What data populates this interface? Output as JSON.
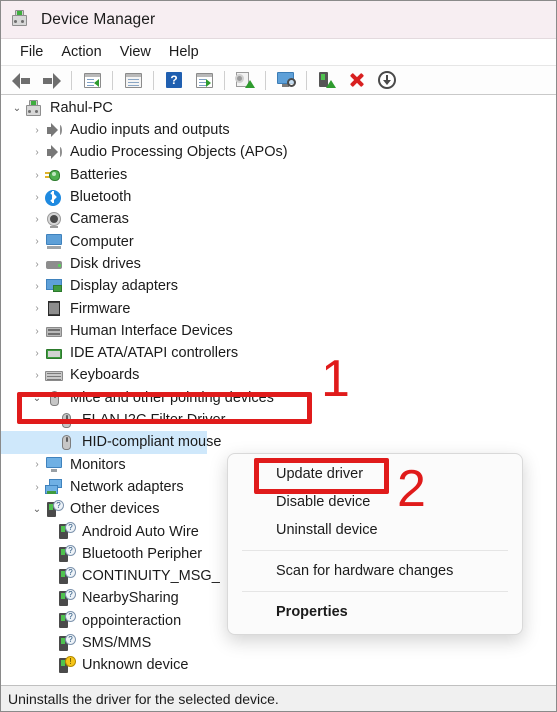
{
  "window": {
    "title": "Device Manager",
    "title_icon": "device-manager-icon"
  },
  "menubar": {
    "items": [
      {
        "label": "File"
      },
      {
        "label": "Action"
      },
      {
        "label": "View"
      },
      {
        "label": "Help"
      }
    ]
  },
  "toolbar": {
    "buttons": [
      {
        "icon": "back-arrow-icon",
        "label": "Back"
      },
      {
        "icon": "forward-arrow-icon",
        "label": "Forward"
      },
      {
        "icon": "show-hide-console-tree-icon",
        "label": "Show/Hide Console Tree"
      },
      {
        "icon": "properties-icon",
        "label": "Properties"
      },
      {
        "icon": "help-icon",
        "label": "Help"
      },
      {
        "icon": "action-icon",
        "label": "Action"
      },
      {
        "icon": "scan-for-hardware-changes-icon",
        "label": "Scan for hardware changes"
      },
      {
        "icon": "device-view-icon",
        "label": "Devices by type"
      },
      {
        "icon": "update-driver-icon",
        "label": "Update driver"
      },
      {
        "icon": "uninstall-device-icon",
        "label": "Uninstall device"
      },
      {
        "icon": "download-icon",
        "label": "Download"
      }
    ]
  },
  "tree": {
    "nodes": [
      {
        "label": "Rahul-PC",
        "level": 0,
        "chevron": "open",
        "icon": "computer-device-icon"
      },
      {
        "label": "Audio inputs and outputs",
        "level": 1,
        "chevron": "closed",
        "icon": "speaker-icon"
      },
      {
        "label": "Audio Processing Objects (APOs)",
        "level": 1,
        "chevron": "closed",
        "icon": "speaker-icon"
      },
      {
        "label": "Batteries",
        "level": 1,
        "chevron": "closed",
        "icon": "battery-icon"
      },
      {
        "label": "Bluetooth",
        "level": 1,
        "chevron": "closed",
        "icon": "bluetooth-icon"
      },
      {
        "label": "Cameras",
        "level": 1,
        "chevron": "closed",
        "icon": "camera-icon"
      },
      {
        "label": "Computer",
        "level": 1,
        "chevron": "closed",
        "icon": "computer-icon"
      },
      {
        "label": "Disk drives",
        "level": 1,
        "chevron": "closed",
        "icon": "disk-drive-icon"
      },
      {
        "label": "Display adapters",
        "level": 1,
        "chevron": "closed",
        "icon": "display-adapter-icon"
      },
      {
        "label": "Firmware",
        "level": 1,
        "chevron": "closed",
        "icon": "firmware-icon"
      },
      {
        "label": "Human Interface Devices",
        "level": 1,
        "chevron": "closed",
        "icon": "hid-icon"
      },
      {
        "label": "IDE ATA/ATAPI controllers",
        "level": 1,
        "chevron": "closed",
        "icon": "ide-controller-icon"
      },
      {
        "label": "Keyboards",
        "level": 1,
        "chevron": "closed",
        "icon": "keyboard-icon"
      },
      {
        "label": "Mice and other pointing devices",
        "level": 1,
        "chevron": "open",
        "icon": "mouse-icon"
      },
      {
        "label": "ELAN I2C Filter Driver",
        "level": 2,
        "chevron": "none",
        "icon": "mouse-icon"
      },
      {
        "label": "HID-compliant mouse",
        "level": 2,
        "chevron": "none",
        "icon": "mouse-icon",
        "selected": true
      },
      {
        "label": "Monitors",
        "level": 1,
        "chevron": "closed",
        "icon": "monitor-icon"
      },
      {
        "label": "Network adapters",
        "level": 1,
        "chevron": "closed",
        "icon": "network-adapter-icon"
      },
      {
        "label": "Other devices",
        "level": 1,
        "chevron": "open",
        "icon": "unknown-device-icon"
      },
      {
        "label": "Android Auto Wire",
        "level": 2,
        "chevron": "none",
        "icon": "unknown-device-icon"
      },
      {
        "label": "Bluetooth Peripher",
        "level": 2,
        "chevron": "none",
        "icon": "unknown-device-icon"
      },
      {
        "label": "CONTINUITY_MSG_",
        "level": 2,
        "chevron": "none",
        "icon": "unknown-device-icon"
      },
      {
        "label": "NearbySharing",
        "level": 2,
        "chevron": "none",
        "icon": "unknown-device-icon"
      },
      {
        "label": "oppointeraction",
        "level": 2,
        "chevron": "none",
        "icon": "unknown-device-icon"
      },
      {
        "label": "SMS/MMS",
        "level": 2,
        "chevron": "none",
        "icon": "unknown-device-icon"
      },
      {
        "label": "Unknown device",
        "level": 2,
        "chevron": "none",
        "icon": "unknown-device-warning-icon"
      }
    ]
  },
  "context_menu": {
    "items": [
      {
        "label": "Update driver",
        "bold": false,
        "highlighted": true
      },
      {
        "label": "Disable device",
        "bold": false
      },
      {
        "label": "Uninstall device",
        "bold": false
      },
      {
        "separator": true
      },
      {
        "label": "Scan for hardware changes",
        "bold": false
      },
      {
        "separator": true
      },
      {
        "label": "Properties",
        "bold": true
      }
    ]
  },
  "annotations": {
    "color": "#e01b1b",
    "step_one": "1",
    "step_two": "2",
    "box_one_target": "Mice and other pointing devices",
    "box_two_target": "Update driver"
  },
  "statusbar": {
    "text": "Uninstalls the driver for the selected device."
  }
}
